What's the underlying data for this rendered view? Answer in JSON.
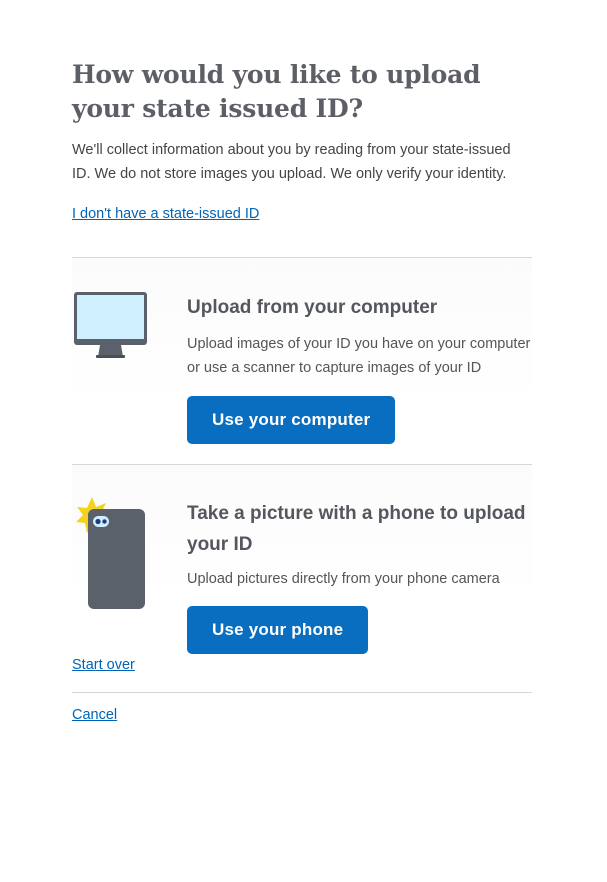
{
  "page": {
    "title": "How would you like to upload your state issued ID?",
    "intro": "We'll collect information about you by reading from your state-issued ID. We do not store images you upload. We only verify your identity.",
    "no_id_link": "I don't have a state-issued ID"
  },
  "options": [
    {
      "icon": "computer-monitor-icon",
      "title": "Upload from your computer",
      "description": "Upload images of your ID you have on your computer or use a scanner to capture images of your ID",
      "button_label": "Use your computer"
    },
    {
      "icon": "phone-camera-icon",
      "title": "Take a picture with a phone to upload your ID",
      "description": "Upload pictures directly from your phone camera",
      "button_label": "Use your phone"
    }
  ],
  "footer": {
    "start_over": "Start over",
    "cancel": "Cancel"
  },
  "colors": {
    "primary_button": "#0a6ec0",
    "link": "#0064b8",
    "heading": "#5c5f66",
    "icon_dark": "#5b616b",
    "monitor_screen": "#cfefff",
    "flash": "#f5d31c"
  }
}
